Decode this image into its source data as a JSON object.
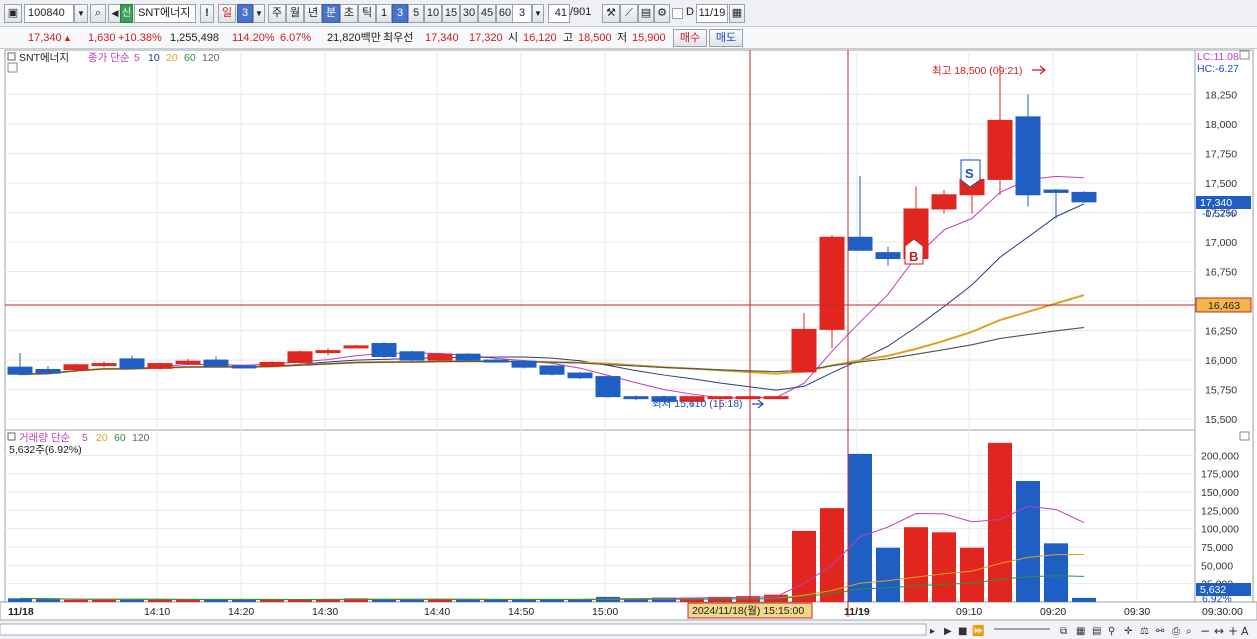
{
  "toolbar": {
    "code": "100840",
    "badge": "신",
    "name": "SNT에너지",
    "exclaim": "!",
    "period_il": "일",
    "period_val": "3",
    "ju": "주",
    "wol": "월",
    "nyeon": "년",
    "bun": "분",
    "cho": "초",
    "tick": "틱",
    "i1": "1",
    "i3": "3",
    "i5": "5",
    "i10": "10",
    "i15": "15",
    "i30": "30",
    "i45": "45",
    "i60": "60",
    "interval": "3",
    "count": "41",
    "count_total": "/901",
    "d_label": "D",
    "date": "11/19"
  },
  "quote": {
    "price": "17,340",
    "change": "1,630",
    "change_pct": "+10.38%",
    "volume": "1,255,498",
    "vol_ratio": "114.20%",
    "turnover": "6.07%",
    "amount": "21,820백만",
    "best_label": "최우선",
    "ask": "17,340",
    "bid": "17,320",
    "open_label": "시",
    "open": "16,120",
    "high_label": "고",
    "high": "18,500",
    "low_label": "저",
    "low": "15,900",
    "buy_label": "매수",
    "sell_label": "매도"
  },
  "price_panel": {
    "stock_label": "SNT에너지",
    "ma_title": "종가 단순",
    "ma_periods": [
      "5",
      "10",
      "20",
      "60",
      "120"
    ],
    "lc": "LC:11.08",
    "hc": "HC:-6.27",
    "current_price": "17,340",
    "current_change": "-0.57%",
    "crosshair_price": "16,463",
    "high_annotation": "최고 18,500 (09:21)",
    "low_annotation": "최저 15,610 (15:18)",
    "buy_signal": "B",
    "sell_signal": "S",
    "y_ticks": [
      "18,250",
      "18,000",
      "17,750",
      "17,500",
      "17,250",
      "17,000",
      "16,750",
      "16,500",
      "16,250",
      "16,000",
      "15,750",
      "15,500"
    ]
  },
  "volume_panel": {
    "title": "거래량 단순",
    "ma_periods": [
      "5",
      "20",
      "60",
      "120"
    ],
    "value": "5,632주(6.92%)",
    "current": "5,632",
    "current_pct": "6.92%",
    "y_ticks": [
      "200,000",
      "175,000",
      "150,000",
      "125,000",
      "100,000",
      "75,000",
      "50,000",
      "25,000"
    ]
  },
  "x_axis": {
    "labels": [
      "11/18",
      "14:10",
      "14:20",
      "14:30",
      "14:40",
      "14:50",
      "15:00",
      "11/19",
      "09:10",
      "09:20",
      "09:30"
    ],
    "crosshair": "2024/11/18(월) 15:15:00",
    "right_time": "09:30:00"
  },
  "colors": {
    "up": "#e0261e",
    "down": "#1f5fc4",
    "ma5": "#c23cc0",
    "ma10": "#2a3a8a",
    "ma20": "#e0a020",
    "ma60": "#2a9040",
    "ma120": "#555555"
  },
  "chart_data": {
    "type": "candlestick",
    "session_1": "11/18",
    "session_2": "11/19",
    "candles": [
      {
        "o": 15940,
        "h": 16060,
        "l": 15870,
        "c": 15880
      },
      {
        "o": 15920,
        "h": 15950,
        "l": 15880,
        "c": 15890
      },
      {
        "o": 15920,
        "h": 15970,
        "l": 15900,
        "c": 15960
      },
      {
        "o": 15960,
        "h": 15990,
        "l": 15940,
        "c": 15970
      },
      {
        "o": 16010,
        "h": 16040,
        "l": 15930,
        "c": 15930
      },
      {
        "o": 15930,
        "h": 15980,
        "l": 15920,
        "c": 15970
      },
      {
        "o": 15970,
        "h": 16010,
        "l": 15960,
        "c": 15990
      },
      {
        "o": 16000,
        "h": 16030,
        "l": 15940,
        "c": 15950
      },
      {
        "o": 15950,
        "h": 15960,
        "l": 15930,
        "c": 15940
      },
      {
        "o": 15950,
        "h": 15990,
        "l": 15940,
        "c": 15980
      },
      {
        "o": 15980,
        "h": 16080,
        "l": 15970,
        "c": 16070
      },
      {
        "o": 16070,
        "h": 16100,
        "l": 16040,
        "c": 16080
      },
      {
        "o": 16120,
        "h": 16130,
        "l": 16100,
        "c": 16120
      },
      {
        "o": 16140,
        "h": 16150,
        "l": 16020,
        "c": 16030
      },
      {
        "o": 16070,
        "h": 16080,
        "l": 15990,
        "c": 16000
      },
      {
        "o": 16000,
        "h": 16060,
        "l": 15990,
        "c": 16050
      },
      {
        "o": 16050,
        "h": 16060,
        "l": 15990,
        "c": 16000
      },
      {
        "o": 16000,
        "h": 16010,
        "l": 15980,
        "c": 15990
      },
      {
        "o": 15990,
        "h": 16000,
        "l": 15930,
        "c": 15940
      },
      {
        "o": 15950,
        "h": 15960,
        "l": 15870,
        "c": 15880
      },
      {
        "o": 15890,
        "h": 15900,
        "l": 15840,
        "c": 15850
      },
      {
        "o": 15860,
        "h": 15870,
        "l": 15680,
        "c": 15690
      },
      {
        "o": 15690,
        "h": 15700,
        "l": 15660,
        "c": 15680
      },
      {
        "o": 15690,
        "h": 15700,
        "l": 15640,
        "c": 15650
      },
      {
        "o": 15650,
        "h": 15700,
        "l": 15610,
        "c": 15690
      },
      {
        "o": 15690,
        "h": 15690,
        "l": 15580,
        "c": 15690
      },
      {
        "o": 15690,
        "h": 15690,
        "l": 15690,
        "c": 15690
      },
      {
        "o": 15690,
        "h": 15690,
        "l": 15690,
        "c": 15690
      },
      {
        "o": 15900,
        "h": 16400,
        "l": 15900,
        "c": 16260
      },
      {
        "o": 16260,
        "h": 17060,
        "l": 16100,
        "c": 17040
      },
      {
        "o": 17040,
        "h": 17560,
        "l": 16960,
        "c": 16930
      },
      {
        "o": 16910,
        "h": 16960,
        "l": 16800,
        "c": 16860
      },
      {
        "o": 16860,
        "h": 17470,
        "l": 16820,
        "c": 17280
      },
      {
        "o": 17280,
        "h": 17440,
        "l": 17240,
        "c": 17400
      },
      {
        "o": 17400,
        "h": 17530,
        "l": 17240,
        "c": 17530
      },
      {
        "o": 17530,
        "h": 18500,
        "l": 17400,
        "c": 18030
      },
      {
        "o": 18060,
        "h": 18250,
        "l": 17300,
        "c": 17400
      },
      {
        "o": 17440,
        "h": 17450,
        "l": 17200,
        "c": 17420
      },
      {
        "o": 17420,
        "h": 17430,
        "l": 17330,
        "c": 17340
      }
    ],
    "volume": [
      5000,
      4000,
      3000,
      3000,
      4000,
      3000,
      3000,
      4000,
      3000,
      3000,
      3000,
      4000,
      5000,
      4000,
      3000,
      4000,
      3000,
      3000,
      4000,
      3000,
      4000,
      7000,
      5000,
      6000,
      5000,
      7000,
      8000,
      10000,
      97000,
      128000,
      202000,
      74000,
      102000,
      95000,
      74000,
      217000,
      165000,
      80000,
      5632
    ],
    "ylim": [
      15450,
      18550
    ],
    "volume_ylim": [
      0,
      225000
    ]
  }
}
